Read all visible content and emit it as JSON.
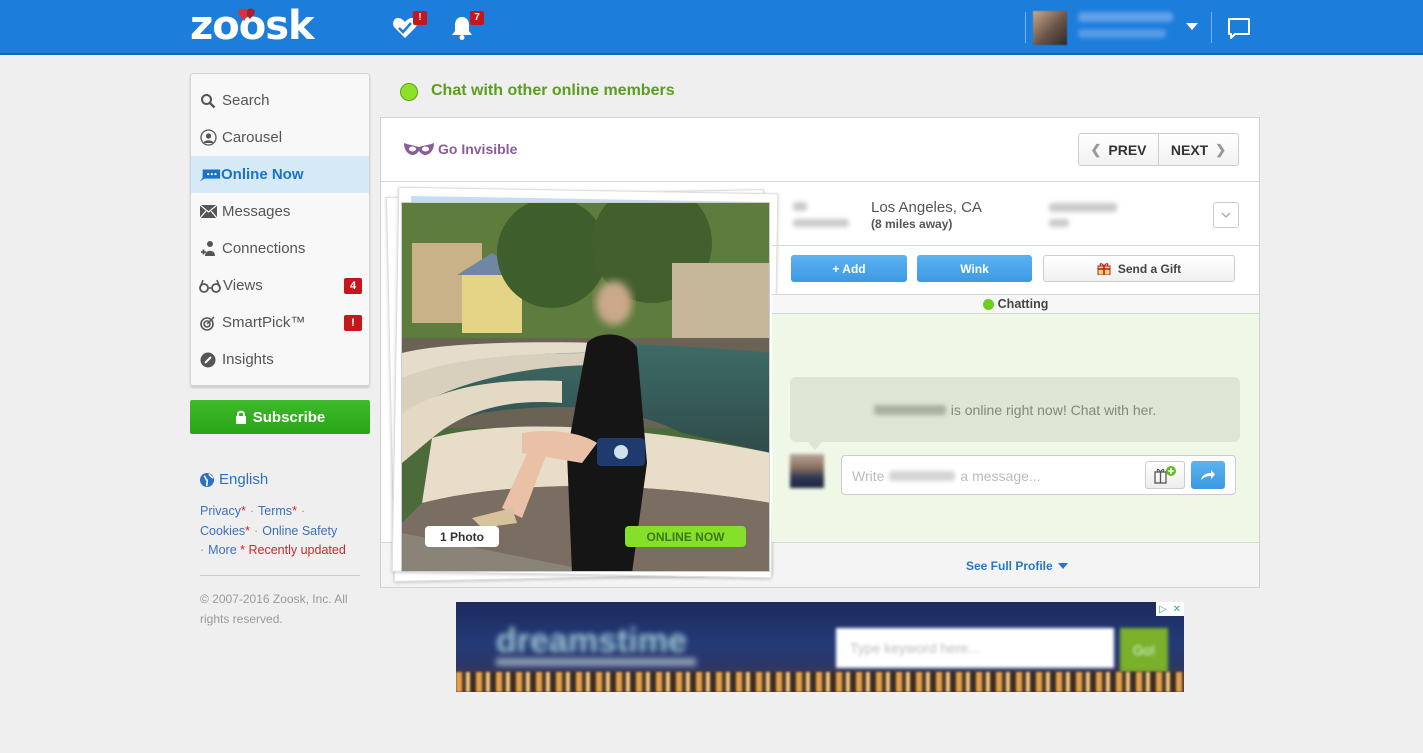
{
  "header": {
    "logo_text": "zoosk",
    "icons": [
      {
        "name": "smartpick-icon",
        "badge": "!"
      },
      {
        "name": "notifications-icon",
        "badge": "7"
      }
    ],
    "user": {
      "name": "A Zoosk member",
      "location": "35, Los Angeles"
    }
  },
  "sidebar": {
    "items": [
      {
        "label": "Search",
        "icon": "search-icon",
        "active": false,
        "badge": null
      },
      {
        "label": "Carousel",
        "icon": "carousel-icon",
        "active": false,
        "badge": null
      },
      {
        "label": "Online Now",
        "icon": "online-chat-icon",
        "active": true,
        "badge": null
      },
      {
        "label": "Messages",
        "icon": "envelope-icon",
        "active": false,
        "badge": null
      },
      {
        "label": "Connections",
        "icon": "connections-icon",
        "active": false,
        "badge": null
      },
      {
        "label": "Views",
        "icon": "glasses-icon",
        "active": false,
        "badge": "4"
      },
      {
        "label": "SmartPick™",
        "icon": "target-icon",
        "active": false,
        "badge": "!"
      },
      {
        "label": "Insights",
        "icon": "insights-icon",
        "active": false,
        "badge": null
      }
    ],
    "subscribe_label": "Subscribe",
    "language": "English",
    "footer": {
      "privacy": "Privacy",
      "terms": "Terms",
      "cookies": "Cookies",
      "online_safety": "Online Safety",
      "more": "More",
      "recently_updated": "* Recently updated",
      "asterisk": "*",
      "copyright": "© 2007-2016 Zoosk, Inc. All rights reserved."
    }
  },
  "main": {
    "title": "Chat with other online members",
    "go_invisible": "Go Invisible",
    "prev": "PREV",
    "next": "NEXT",
    "profile": {
      "age_line": "35",
      "age_sub": "Years Old",
      "city": "Los Angeles, CA",
      "distance": "(8 miles away)",
      "username": "mahbanoo",
      "height": "5'5\"",
      "photo_count": "1 Photo",
      "online_badge": "ONLINE NOW"
    },
    "actions": {
      "add": "+ Add",
      "wink": "Wink",
      "gift": "Send a Gift"
    },
    "chat_status": "Chatting",
    "chat_prompt_suffix": "is online right now! Chat with her.",
    "message_placeholder_prefix": "Write",
    "message_placeholder_suffix": "a message...",
    "see_full_profile": "See Full Profile"
  },
  "ad": {
    "brand": "dreamstime",
    "search_placeholder": "Type keyword here...",
    "go_label": "Go!"
  },
  "colors": {
    "topbar": "#1d7ddb",
    "accent_green": "#5a9e1d",
    "online_green": "#86e02a",
    "subscribe_green": "#2aa418",
    "badge_red": "#c4161c",
    "button_blue": "#3c99e4",
    "invisible_purple": "#8a5d9a"
  }
}
